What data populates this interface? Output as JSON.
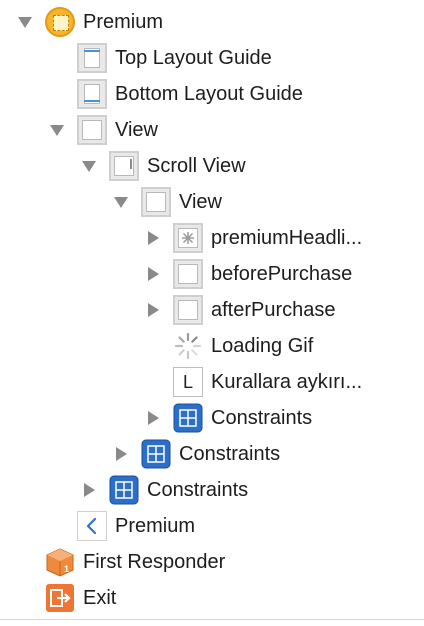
{
  "outline": {
    "premium_scene": "Premium",
    "top_layout_guide": "Top Layout Guide",
    "bottom_layout_guide": "Bottom Layout Guide",
    "view": "View",
    "scroll_view": "Scroll View",
    "inner_view": "View",
    "premium_headline": "premiumHeadli...",
    "before_purchase": "beforePurchase",
    "after_purchase": "afterPurchase",
    "loading_gif": "Loading Gif",
    "rules_label": "Kurallara aykırı...",
    "label_icon_glyph": "L",
    "constraints_inner": "Constraints",
    "constraints_scroll": "Constraints",
    "constraints_view": "Constraints",
    "back_item": "Premium",
    "first_responder": "First Responder",
    "exit": "Exit"
  },
  "colors": {
    "disclosure": "#8a8a8a",
    "constraints_blue": "#2c6fc9",
    "vc_yellow": "#f6b52b",
    "exit_orange": "#ee7534"
  },
  "icons": [
    "view-controller-icon",
    "layout-guide-icon",
    "view-icon",
    "scroll-view-icon",
    "image-view-icon",
    "activity-indicator-icon",
    "label-icon",
    "constraints-icon",
    "back-chevron-icon",
    "first-responder-icon",
    "exit-icon",
    "disclosure-triangle-icon"
  ]
}
